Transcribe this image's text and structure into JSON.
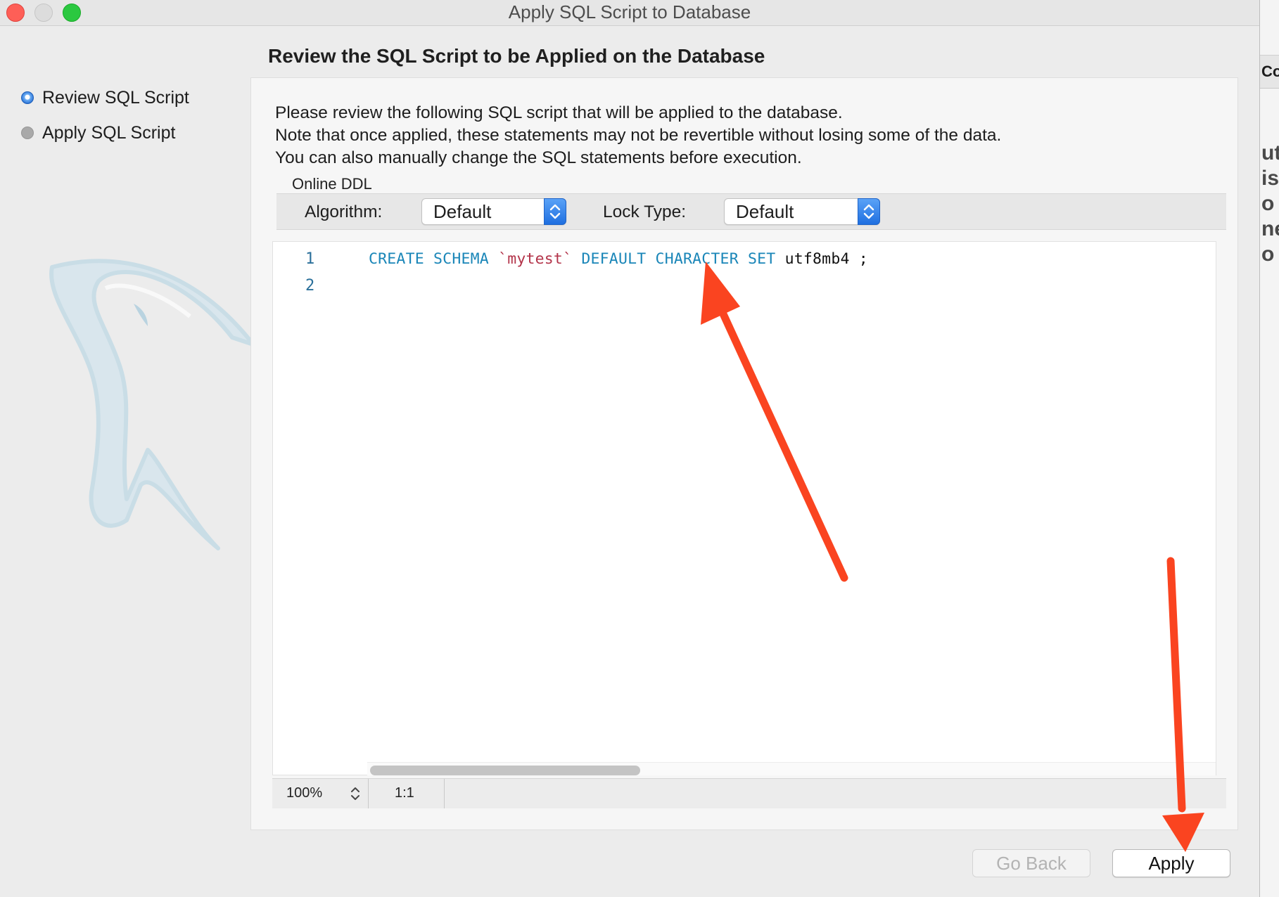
{
  "window": {
    "title": "Apply SQL Script to Database"
  },
  "page": {
    "heading": "Review the SQL Script to be Applied on the Database"
  },
  "steps": [
    {
      "label": "Review SQL Script",
      "state": "active"
    },
    {
      "label": "Apply SQL Script",
      "state": "inactive"
    }
  ],
  "intro": {
    "line1": "Please review the following SQL script that will be applied to the database.",
    "line2": "Note that once applied, these statements may not be revertible without losing some of the data.",
    "line3": "You can also manually change the SQL statements before execution."
  },
  "online_ddl": {
    "group_label": "Online DDL",
    "algorithm_label": "Algorithm:",
    "algorithm_value": "Default",
    "lock_type_label": "Lock Type:",
    "lock_type_value": "Default"
  },
  "editor": {
    "line_numbers": [
      "1",
      "2"
    ],
    "code_tokens": {
      "create": "CREATE",
      "schema": "SCHEMA",
      "name": "`mytest`",
      "default": "DEFAULT",
      "character": "CHARACTER",
      "set": "SET",
      "charset": "utf8mb4",
      "terminator": ";"
    }
  },
  "statusbar": {
    "zoom": "100%",
    "cursor": "1:1"
  },
  "buttons": {
    "go_back": "Go Back",
    "apply": "Apply"
  },
  "background_window": {
    "tab_text": "Co",
    "lines": [
      "ut",
      "is",
      "o",
      "ne",
      "o"
    ]
  },
  "colors": {
    "keyword": "#1a86b8",
    "string": "#b3344a",
    "annotation_arrow": "#fa4420",
    "accent": "#2a72d6"
  }
}
